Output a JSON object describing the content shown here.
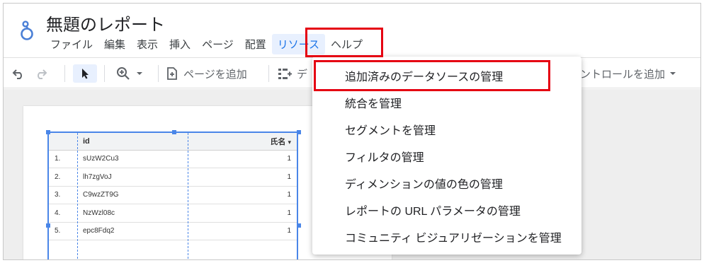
{
  "report": {
    "title": "無題のレポート"
  },
  "menubar": {
    "items": [
      "ファイル",
      "編集",
      "表示",
      "挿入",
      "ページ",
      "配置",
      "リソース",
      "ヘルプ"
    ]
  },
  "toolbar": {
    "add_page_label": "ページを追加",
    "partial_label": "デ",
    "add_control_label": "ントロールを追加"
  },
  "resource_menu": {
    "items": [
      "追加済みのデータソースの管理",
      "統合を管理",
      "セグメントを管理",
      "フィルタの管理",
      "ディメンションの値の色の管理",
      "レポートの URL パラメータの管理",
      "コミュニティ ビジュアリゼーションを管理"
    ]
  },
  "table": {
    "headers": {
      "id": "id",
      "name": "氏名"
    },
    "rows": [
      {
        "num": "1.",
        "id": "sUzW2Cu3",
        "name": "1"
      },
      {
        "num": "2.",
        "id": "lh7zgVoJ",
        "name": "1"
      },
      {
        "num": "3.",
        "id": "C9wzZT9G",
        "name": "1"
      },
      {
        "num": "4.",
        "id": "NzWzl08c",
        "name": "1"
      },
      {
        "num": "5.",
        "id": "epc8Fdq2",
        "name": "1"
      }
    ]
  },
  "colors": {
    "accent": "#1a73e8",
    "highlight": "#e50012",
    "selection": "#4a86e8"
  }
}
